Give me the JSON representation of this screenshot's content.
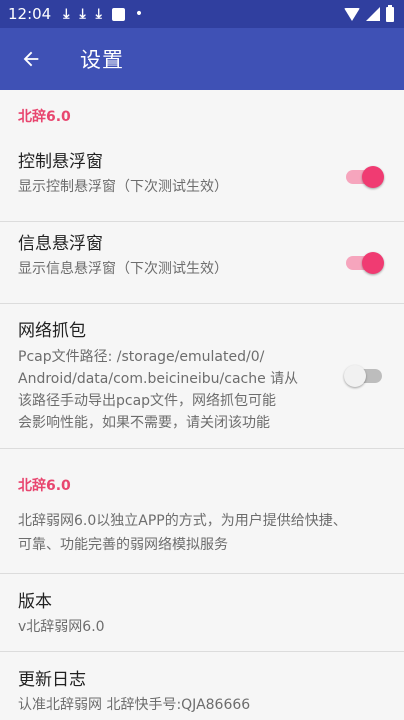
{
  "status_bar": {
    "time": "12:04",
    "icons": [
      "download-icon",
      "download-icon",
      "download-icon",
      "notification-square-icon",
      "dot-icon",
      "wifi-icon",
      "signal-icon",
      "battery-icon"
    ]
  },
  "app_bar": {
    "title": "设置"
  },
  "sections": {
    "cat1": "北辞6.0",
    "control_float": {
      "title": "控制悬浮窗",
      "summary": "显示控制悬浮窗（下次测试生效）",
      "checked": true
    },
    "info_float": {
      "title": "信息悬浮窗",
      "summary": "显示信息悬浮窗（下次测试生效）",
      "checked": true
    },
    "capture": {
      "title": "网络抓包",
      "summary_lines": [
        "Pcap文件路径: /storage/emulated/0/",
        "Android/data/com.beicineibu/cache 请从",
        "该路径手动导出pcap文件，网络抓包可能",
        "会影响性能，如果不需要，请关闭该功能"
      ],
      "checked": false
    },
    "cat2": "北辞6.0",
    "about_lines": [
      "北辞弱网6.0以独立APP的方式，为用户提供给快捷、",
      "可靠、功能完善的弱网络模拟服务"
    ],
    "version": {
      "title": "版本",
      "summary": "v北辞弱网6.0"
    },
    "changelog": {
      "title": "更新日志",
      "summary": "认准北辞弱网 北辞快手号:QJA86666"
    }
  },
  "colors": {
    "status_bar": "#303f9f",
    "app_bar": "#3f51b5",
    "accent": "#f03b72",
    "category": "#e8466f"
  }
}
